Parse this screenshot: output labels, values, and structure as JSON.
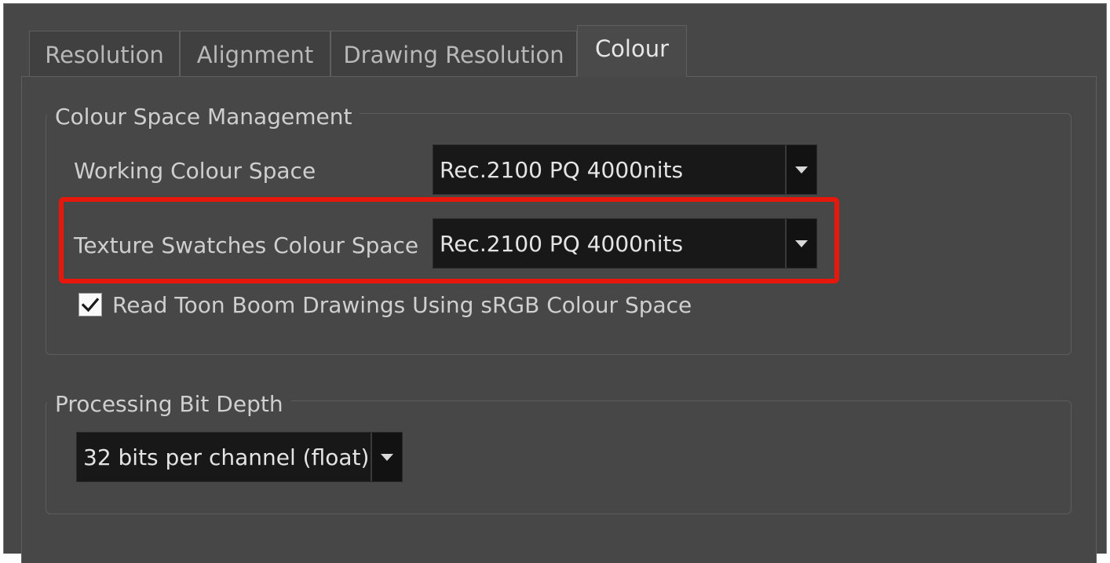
{
  "tabs": [
    {
      "label": "Resolution",
      "active": false
    },
    {
      "label": "Alignment",
      "active": false
    },
    {
      "label": "Drawing Resolution",
      "active": false
    },
    {
      "label": "Colour",
      "active": true
    }
  ],
  "colour_space_management": {
    "title": "Colour Space Management",
    "working_colour_space": {
      "label": "Working Colour Space",
      "value": "Rec.2100 PQ 4000nits"
    },
    "texture_swatches_colour_space": {
      "label": "Texture Swatches Colour Space",
      "value": "Rec.2100 PQ 4000nits",
      "highlighted": true
    },
    "read_toon_boom": {
      "label": "Read Toon Boom Drawings Using sRGB Colour Space",
      "checked": true
    }
  },
  "processing_bit_depth": {
    "title": "Processing Bit Depth",
    "value": "32 bits per channel (float)"
  },
  "colors": {
    "background": "#474747",
    "highlight": "#e8170b",
    "combo_background": "#181818",
    "text": "#cfcfcf"
  }
}
